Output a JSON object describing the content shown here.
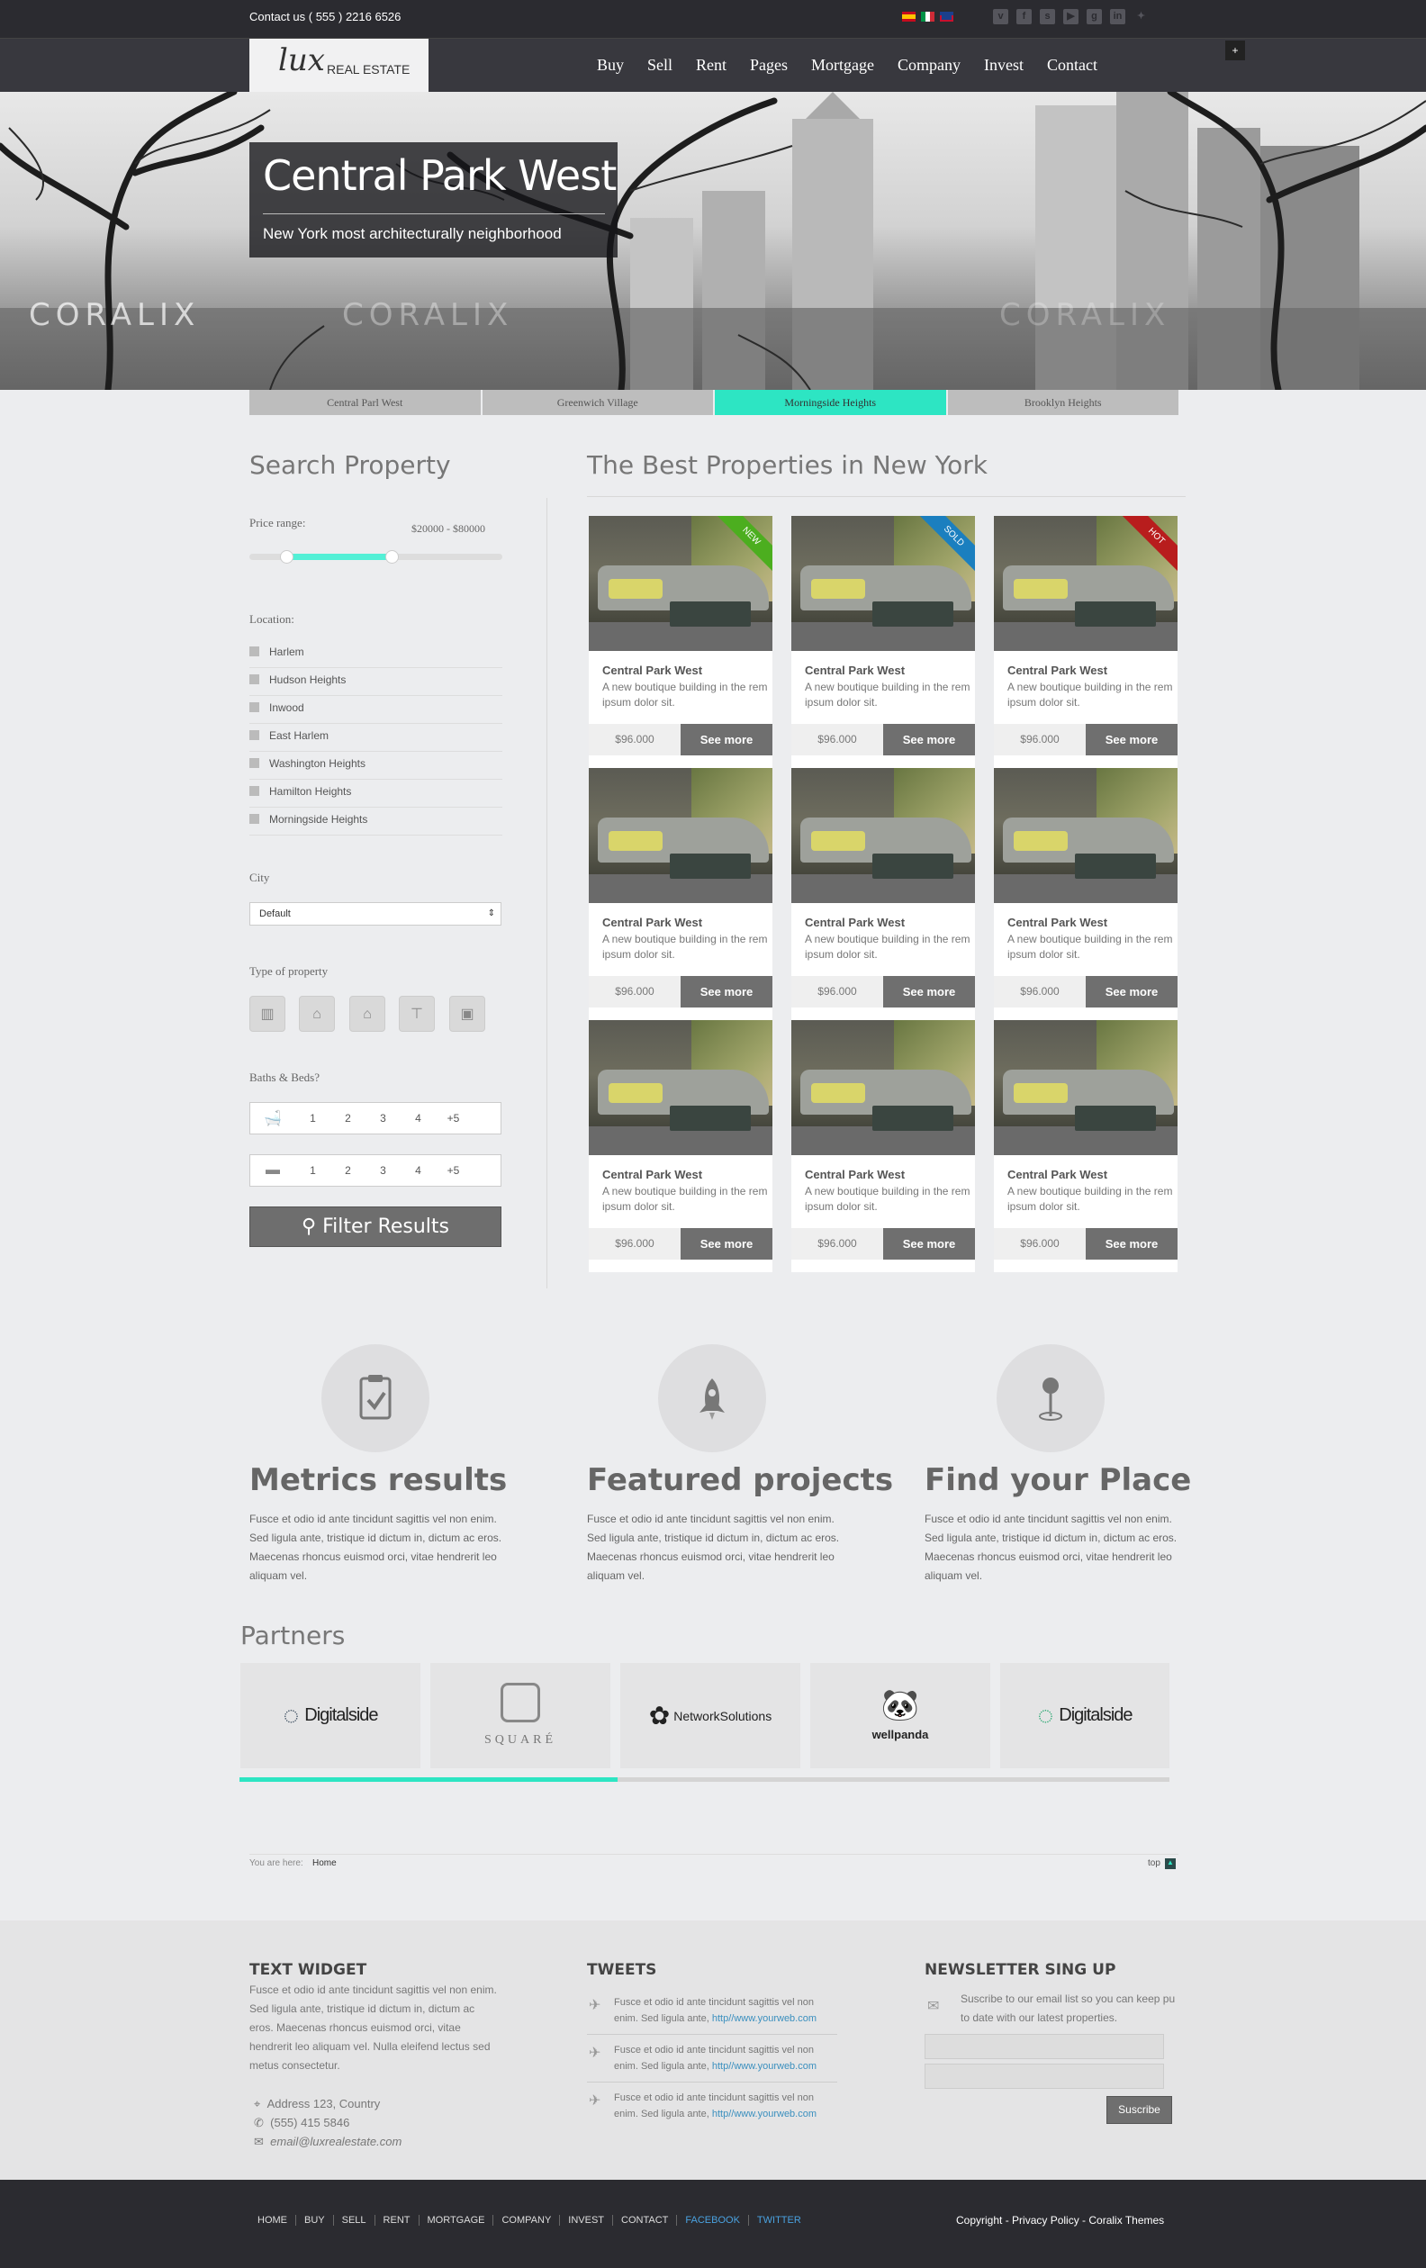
{
  "topbar": {
    "contact": "Contact us ( 555 ) 2216 6526",
    "flags": [
      "es-flag",
      "it-flag",
      "uk-flag"
    ],
    "social_icons": [
      "vimeo-icon",
      "facebook-icon",
      "skype-icon",
      "youtube-icon",
      "googleplus-icon",
      "linkedin-icon",
      "twitter-icon"
    ]
  },
  "brand": {
    "logo_script": "lux",
    "logo_text": "REAL ESTATE"
  },
  "nav": {
    "items": [
      "Buy",
      "Sell",
      "Rent",
      "Pages",
      "Mortgage",
      "Company",
      "Invest",
      "Contact"
    ],
    "plus": "+"
  },
  "hero": {
    "title": "Central Park West",
    "subtitle": "New York most architecturally neighborhood",
    "watermark": "CORALIX"
  },
  "tabs": [
    {
      "label": "Central Parl West",
      "active": false
    },
    {
      "label": "Greenwich Village",
      "active": false
    },
    {
      "label": "Morningside Heights",
      "active": true
    },
    {
      "label": "Brooklyn Heights",
      "active": false
    }
  ],
  "search": {
    "heading": "Search Property",
    "price_label": "Price range:",
    "price_value": "$20000 - $80000",
    "price_low_fraction": 0.17,
    "price_high_fraction": 0.57,
    "location_label": "Location:",
    "locations": [
      "Harlem",
      "Hudson Heights",
      "Inwood",
      "East Harlem",
      "Washington Heights",
      "Hamilton Heights",
      "Morningside Heights"
    ],
    "city_label": "City",
    "city_value": "Default",
    "type_label": "Type of property",
    "type_icons": [
      "building-icon",
      "factory-icon",
      "house-icon",
      "sign-icon",
      "briefcase-icon"
    ],
    "baths_label": "Baths & Beds?",
    "bath_options": [
      "1",
      "2",
      "3",
      "4",
      "+5"
    ],
    "bed_options": [
      "1",
      "2",
      "3",
      "4",
      "+5"
    ],
    "filter_label": "Filter Results"
  },
  "listings": {
    "heading": "The Best Properties in New York",
    "cards": [
      {
        "title": "Central Park West",
        "desc": "A new boutique building in the rem ipsum dolor sit.",
        "price": "$96.000",
        "button": "See more",
        "ribbon": "NEW",
        "ribbon_color": "#4cae1f"
      },
      {
        "title": "Central Park West",
        "desc": "A new boutique building in the rem ipsum dolor sit.",
        "price": "$96.000",
        "button": "See more",
        "ribbon": "SOLD",
        "ribbon_color": "#1b7fbf"
      },
      {
        "title": "Central Park West",
        "desc": "A new boutique building in the rem ipsum dolor sit.",
        "price": "$96.000",
        "button": "See more",
        "ribbon": "HOT",
        "ribbon_color": "#b81d1d"
      },
      {
        "title": "Central Park West",
        "desc": "A new boutique building in the rem ipsum dolor sit.",
        "price": "$96.000",
        "button": "See more",
        "ribbon": "",
        "ribbon_color": ""
      },
      {
        "title": "Central Park West",
        "desc": "A new boutique building in the rem ipsum dolor sit.",
        "price": "$96.000",
        "button": "See more",
        "ribbon": "",
        "ribbon_color": ""
      },
      {
        "title": "Central Park West",
        "desc": "A new boutique building in the rem ipsum dolor sit.",
        "price": "$96.000",
        "button": "See more",
        "ribbon": "",
        "ribbon_color": ""
      },
      {
        "title": "Central Park West",
        "desc": "A new boutique building in the rem ipsum dolor sit.",
        "price": "$96.000",
        "button": "See more",
        "ribbon": "",
        "ribbon_color": ""
      },
      {
        "title": "Central Park West",
        "desc": "A new boutique building in the rem ipsum dolor sit.",
        "price": "$96.000",
        "button": "See more",
        "ribbon": "",
        "ribbon_color": ""
      },
      {
        "title": "Central Park West",
        "desc": "A new boutique building in the rem ipsum dolor sit.",
        "price": "$96.000",
        "button": "See more",
        "ribbon": "",
        "ribbon_color": ""
      }
    ]
  },
  "features": [
    {
      "title": "Metrics results",
      "icon": "clipboard-check-icon",
      "text": "Fusce et odio id ante tincidunt sagittis vel non enim. Sed ligula ante, tristique id dictum in, dictum ac eros. Maecenas rhoncus euismod orci, vitae hendrerit leo aliquam vel."
    },
    {
      "title": "Featured projects",
      "icon": "rocket-icon",
      "text": "Fusce et odio id ante tincidunt sagittis vel non enim. Sed ligula ante, tristique id dictum in, dictum ac eros. Maecenas rhoncus euismod orci, vitae hendrerit leo aliquam vel."
    },
    {
      "title": "Find your Place",
      "icon": "map-pin-icon",
      "text": "Fusce et odio id ante tincidunt sagittis vel non enim. Sed ligula ante, tristique id dictum in, dictum ac eros. Maecenas rhoncus euismod orci, vitae hendrerit leo aliquam vel."
    }
  ],
  "partners": {
    "heading": "Partners",
    "logos": [
      "Digitalside",
      "SQUARÉ",
      "NetworkSolutions",
      "wellpanda",
      "Digitalside"
    ],
    "scroll_fraction": 0.41
  },
  "breadcrumb": {
    "prefix": "You are here:",
    "current": "Home",
    "top": "top"
  },
  "footer": {
    "text_widget": {
      "heading": "TEXT WIDGET",
      "text": "Fusce et odio id ante tincidunt sagittis vel non enim. Sed ligula ante, tristique id dictum in, dictum ac eros. Maecenas rhoncus euismod orci, vitae hendrerit leo aliquam vel. Nulla eleifend lectus sed metus consectetur.",
      "address": "Address 123, Country",
      "phone": "(555) 415 5846",
      "email": "email@luxrealestate.com"
    },
    "tweets": {
      "heading": "TWEETS",
      "items": [
        {
          "text": "Fusce et odio id ante tincidunt sagittis vel non enim. Sed ligula ante,",
          "link": "http//www.yourweb.com"
        },
        {
          "text": "Fusce et odio id ante tincidunt sagittis vel non enim. Sed ligula ante,",
          "link": "http//www.yourweb.com"
        },
        {
          "text": "Fusce et odio id ante tincidunt sagittis vel non enim. Sed ligula ante,",
          "link": "http//www.yourweb.com"
        }
      ]
    },
    "newsletter": {
      "heading": "NEWSLETTER SING UP",
      "text": "Suscribe to our email list so you can keep pu to date with our latest properties.",
      "button": "Suscribe"
    }
  },
  "bottom": {
    "menu": [
      "HOME",
      "BUY",
      "SELL",
      "RENT",
      "MORTGAGE",
      "COMPANY",
      "INVEST",
      "CONTACT",
      "FACEBOOK",
      "TWITTER"
    ],
    "copyright": "Copyright - Privacy Policy - Coralix Themes"
  }
}
